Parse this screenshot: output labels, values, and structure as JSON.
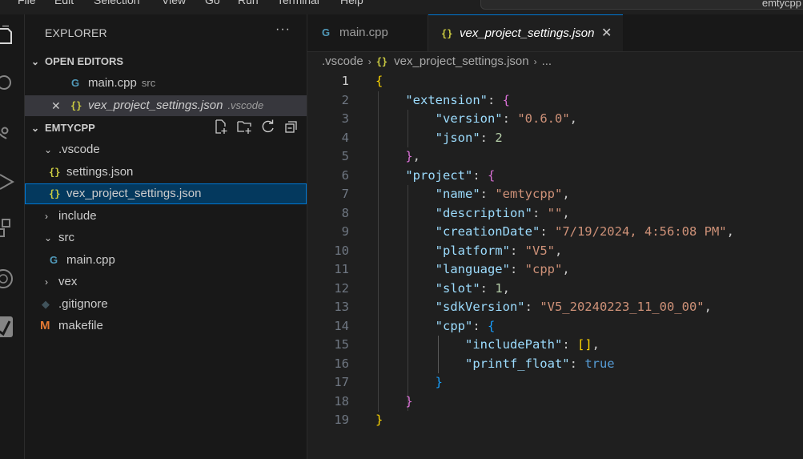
{
  "menu": {
    "items": [
      "File",
      "Edit",
      "Selection",
      "View",
      "Go",
      "Run",
      "Terminal",
      "Help"
    ],
    "search_text": "emtycpp"
  },
  "activity_bar": {
    "icons": [
      "explorer-icon",
      "search-icon",
      "source-control-icon",
      "run-debug-icon",
      "extensions-icon",
      "vex-icon",
      "checkmark-icon"
    ]
  },
  "explorer": {
    "title": "EXPLORER",
    "more": "···",
    "open_editors": {
      "label": "OPEN EDITORS",
      "items": [
        {
          "name": "main.cpp",
          "desc": "src"
        },
        {
          "name": "vex_project_settings.json",
          "desc": ".vscode",
          "close": "✕"
        }
      ]
    },
    "workspace": {
      "label": "EMTYCPP",
      "tree": {
        "vscode": ".vscode",
        "settings": "settings.json",
        "vex_settings": "vex_project_settings.json",
        "include": "include",
        "src": "src",
        "main": "main.cpp",
        "vex": "vex",
        "gitignore": ".gitignore",
        "makefile": "makefile"
      }
    }
  },
  "tabs": [
    {
      "label": "main.cpp"
    },
    {
      "label": "vex_project_settings.json",
      "close": "✕"
    }
  ],
  "icons": {
    "json": "{}",
    "cpp": "G",
    "makefile": "M",
    "git": "◆"
  },
  "breadcrumb": {
    "folder": ".vscode",
    "file": "vex_project_settings.json",
    "more": "..."
  },
  "code": {
    "line_numbers": [
      "1",
      "2",
      "3",
      "4",
      "5",
      "6",
      "7",
      "8",
      "9",
      "10",
      "11",
      "12",
      "13",
      "14",
      "15",
      "16",
      "17",
      "18",
      "19"
    ],
    "current_line": "1",
    "tokens": {
      "l1": "{",
      "l2k": "\"extension\"",
      "l2p": ": ",
      "l2b": "{",
      "l3k": "\"version\"",
      "l3p": ": ",
      "l3s": "\"0.6.0\"",
      "l3c": ",",
      "l4k": "\"json\"",
      "l4p": ": ",
      "l4n": "2",
      "l5b": "}",
      "l5c": ",",
      "l6k": "\"project\"",
      "l6p": ": ",
      "l6b": "{",
      "l7k": "\"name\"",
      "l7p": ": ",
      "l7s": "\"emtycpp\"",
      "l7c": ",",
      "l8k": "\"description\"",
      "l8p": ": ",
      "l8s": "\"\"",
      "l8c": ",",
      "l9k": "\"creationDate\"",
      "l9p": ": ",
      "l9s": "\"7/19/2024, 4:56:08 PM\"",
      "l9c": ",",
      "l10k": "\"platform\"",
      "l10p": ": ",
      "l10s": "\"V5\"",
      "l10c": ",",
      "l11k": "\"language\"",
      "l11p": ": ",
      "l11s": "\"cpp\"",
      "l11c": ",",
      "l12k": "\"slot\"",
      "l12p": ": ",
      "l12n": "1",
      "l12c": ",",
      "l13k": "\"sdkVersion\"",
      "l13p": ": ",
      "l13s": "\"V5_20240223_11_00_00\"",
      "l13c": ",",
      "l14k": "\"cpp\"",
      "l14p": ": ",
      "l14b": "{",
      "l15k": "\"includePath\"",
      "l15p": ": ",
      "l15a": "[]",
      "l15c": ",",
      "l16k": "\"printf_float\"",
      "l16p": ": ",
      "l16v": "true",
      "l17b": "}",
      "l18b": "}",
      "l19": "}"
    }
  }
}
